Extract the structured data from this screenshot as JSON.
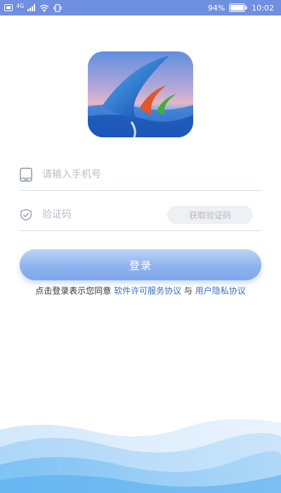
{
  "status_bar": {
    "network_label": "4G",
    "battery_percent": "94%",
    "time": "10:02"
  },
  "login": {
    "phone_placeholder": "请输入手机号",
    "code_placeholder": "验证码",
    "get_code_label": "获取验证码",
    "login_label": "登录"
  },
  "agreement": {
    "prefix": "点击登录表示您同意 ",
    "license_link": "软件许可服务协议",
    "connector": " 与 ",
    "privacy_link": "用户隐私协议"
  },
  "colors": {
    "status_bar": "#6f8fe0",
    "primary_button": "#8fb3ee",
    "link": "#3d6fbf",
    "placeholder": "#b9bec7"
  },
  "icons": [
    "sim-icon",
    "signal-icon",
    "wifi-icon",
    "vibrate-icon",
    "battery-icon",
    "phone-icon",
    "shield-check-icon"
  ]
}
